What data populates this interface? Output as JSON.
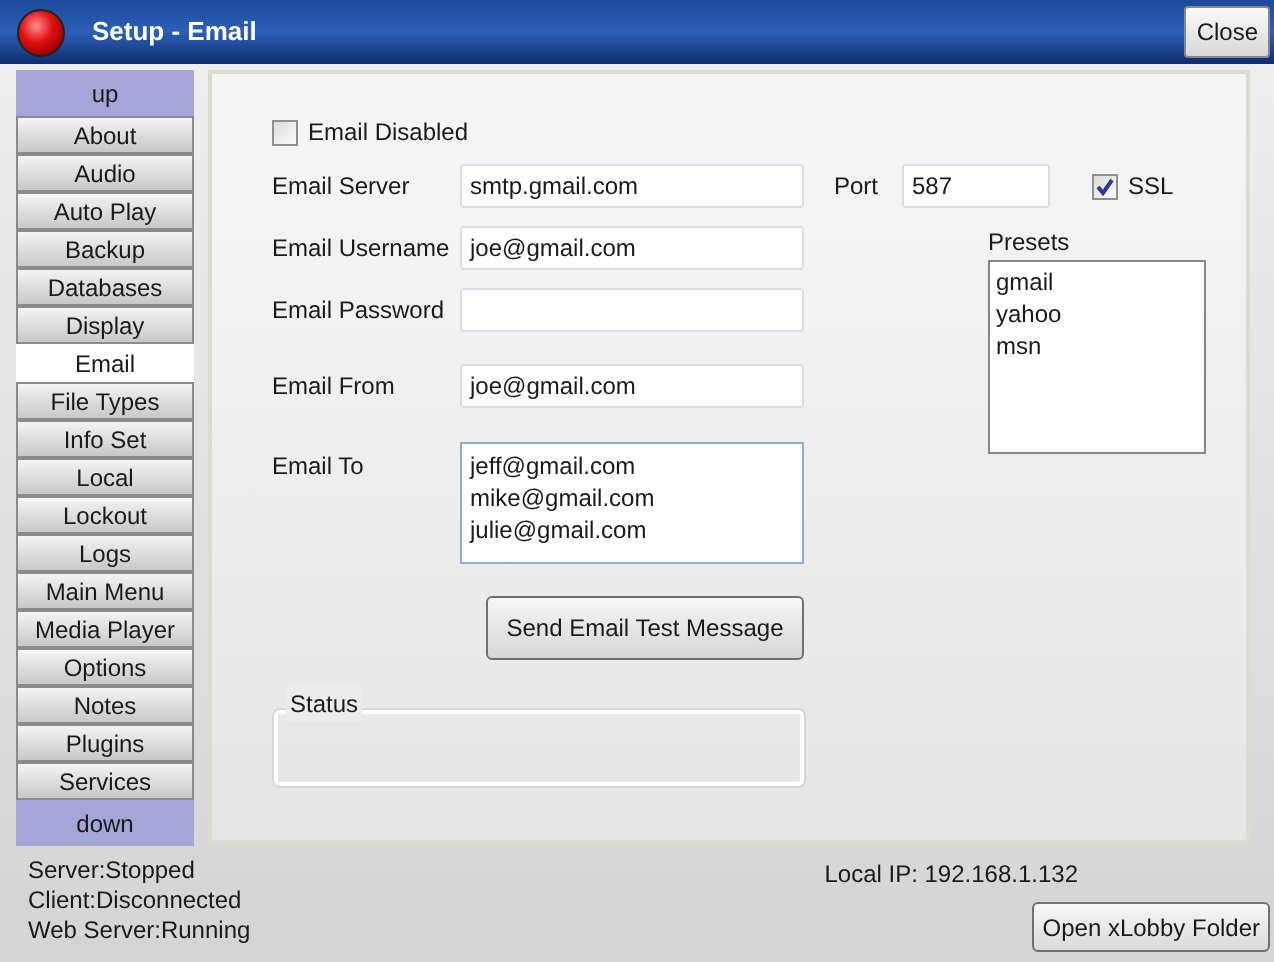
{
  "window": {
    "title": "Setup - Email",
    "close_button": "Close"
  },
  "sidebar": {
    "items": [
      {
        "label": "up",
        "kind": "scroll",
        "selected": false
      },
      {
        "label": "About",
        "kind": "nav",
        "selected": false
      },
      {
        "label": "Audio",
        "kind": "nav",
        "selected": false
      },
      {
        "label": "Auto Play",
        "kind": "nav",
        "selected": false
      },
      {
        "label": "Backup",
        "kind": "nav",
        "selected": false
      },
      {
        "label": "Databases",
        "kind": "nav",
        "selected": false
      },
      {
        "label": "Display",
        "kind": "nav",
        "selected": false
      },
      {
        "label": "Email",
        "kind": "nav",
        "selected": true
      },
      {
        "label": "File Types",
        "kind": "nav",
        "selected": false
      },
      {
        "label": "Info Set",
        "kind": "nav",
        "selected": false
      },
      {
        "label": "Local",
        "kind": "nav",
        "selected": false
      },
      {
        "label": "Lockout",
        "kind": "nav",
        "selected": false
      },
      {
        "label": "Logs",
        "kind": "nav",
        "selected": false
      },
      {
        "label": "Main Menu",
        "kind": "nav",
        "selected": false
      },
      {
        "label": "Media Player",
        "kind": "nav",
        "selected": false
      },
      {
        "label": "Options",
        "kind": "nav",
        "selected": false
      },
      {
        "label": "Notes",
        "kind": "nav",
        "selected": false
      },
      {
        "label": "Plugins",
        "kind": "nav",
        "selected": false
      },
      {
        "label": "Services",
        "kind": "nav",
        "selected": false
      },
      {
        "label": "down",
        "kind": "scroll",
        "selected": false
      }
    ]
  },
  "form": {
    "email_disabled": {
      "label": "Email Disabled",
      "checked": false
    },
    "server": {
      "label": "Email Server",
      "value": "smtp.gmail.com"
    },
    "port": {
      "label": "Port",
      "value": "587"
    },
    "ssl": {
      "label": "SSL",
      "checked": true
    },
    "username": {
      "label": "Email Username",
      "value": "joe@gmail.com"
    },
    "password": {
      "label": "Email Password"
    },
    "from": {
      "label": "Email From",
      "value": "joe@gmail.com"
    },
    "to": {
      "label": "Email To",
      "lines": [
        "jeff@gmail.com",
        "mike@gmail.com",
        "julie@gmail.com"
      ]
    },
    "test_button": "Send Email Test Message",
    "status_group": {
      "label": "Status"
    },
    "presets": {
      "label": "Presets",
      "items": [
        "gmail",
        "yahoo",
        "msn"
      ]
    }
  },
  "status_lines": [
    "Server:Stopped",
    "Client:Disconnected",
    "Web Server:Running"
  ],
  "local_ip": "Local IP: 192.168.1.132",
  "open_folder_button": "Open xLobby Folder"
}
